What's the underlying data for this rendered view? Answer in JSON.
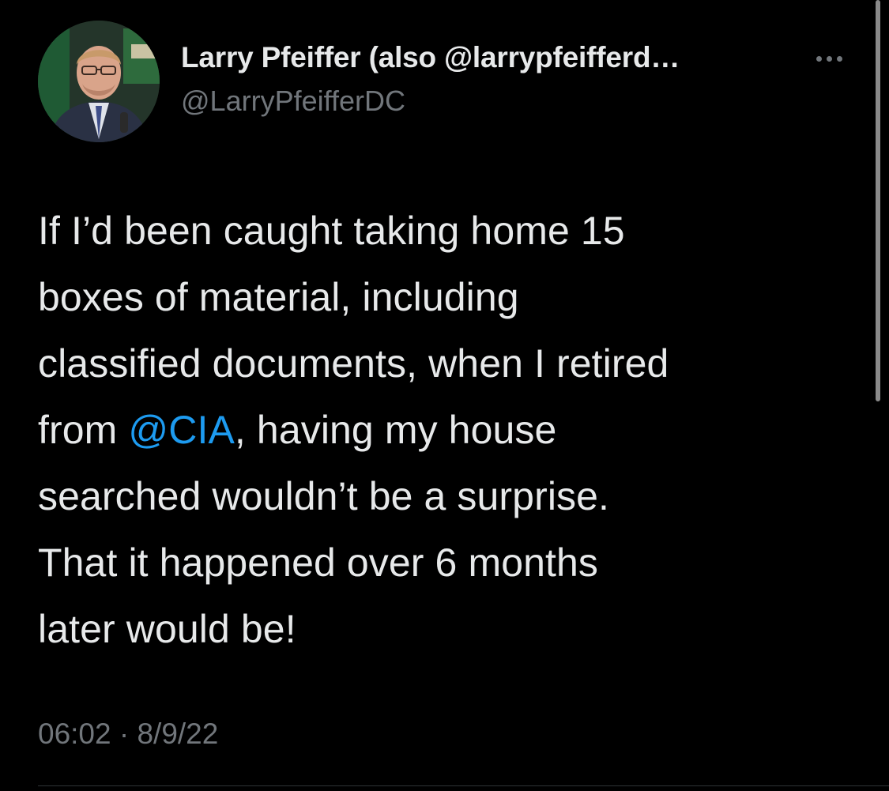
{
  "author": {
    "display_name": "Larry Pfeiffer (also @larrypfeifferd…",
    "handle": "@LarryPfeifferDC",
    "avatar_icon": "profile-photo"
  },
  "more_icon": "more-horizontal-icon",
  "tweet": {
    "text_before_mention": [
      "If I’d been caught taking home 15",
      "boxes of material, including",
      "classified documents, when I retired"
    ],
    "line_with_mention": {
      "prefix": "from ",
      "mention": "@CIA",
      "suffix": ", having my house"
    },
    "text_after_mention": [
      "searched wouldn’t be a surprise.",
      "That it happened over 6 months",
      "later would be!"
    ]
  },
  "timestamp": "06:02 · 8/9/22",
  "colors": {
    "background": "#000000",
    "text": "#e7e9ea",
    "secondary": "#71767b",
    "link": "#1d9bf0"
  }
}
